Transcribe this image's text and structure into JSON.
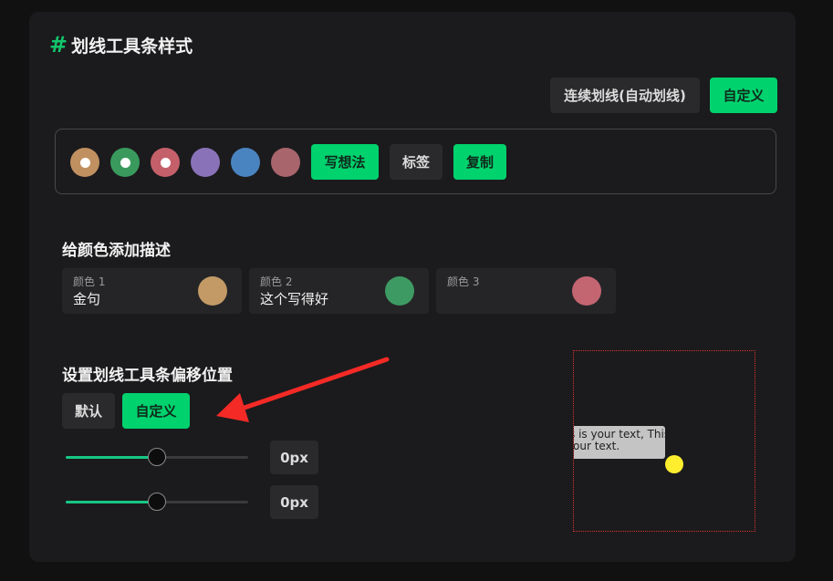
{
  "header": {
    "title": "划线工具条样式"
  },
  "mode_buttons": {
    "continuous": "连续划线(自动划线)",
    "custom": "自定义"
  },
  "palette": {
    "colors": [
      {
        "hex": "#c09060",
        "selected": true
      },
      {
        "hex": "#3a9a5e",
        "selected": true
      },
      {
        "hex": "#c4606a",
        "selected": true
      },
      {
        "hex": "#8a72b8",
        "selected": false
      },
      {
        "hex": "#4a84c0",
        "selected": false
      },
      {
        "hex": "#a8656c",
        "selected": false
      }
    ],
    "actions": {
      "write_idea": "写想法",
      "tag": "标签",
      "copy": "复制"
    }
  },
  "color_desc": {
    "title": "给颜色添加描述",
    "cards": [
      {
        "label": "颜色 1",
        "value": "金句",
        "hex": "#c39a66"
      },
      {
        "label": "颜色 2",
        "value": "这个写得好",
        "hex": "#3e9a63"
      },
      {
        "label": "颜色 3",
        "value": "",
        "hex": "#c46572"
      }
    ]
  },
  "offset": {
    "title": "设置划线工具条偏移位置",
    "default_label": "默认",
    "custom_label": "自定义",
    "sliders": [
      {
        "value": "0px",
        "level_percent": 50
      },
      {
        "value": "0px",
        "level_percent": 50
      }
    ]
  },
  "preview": {
    "line1": "s is your text, This",
    "line2": "our text."
  },
  "colors": {
    "accent": "#00d26e",
    "arrow": "#f42a26"
  }
}
